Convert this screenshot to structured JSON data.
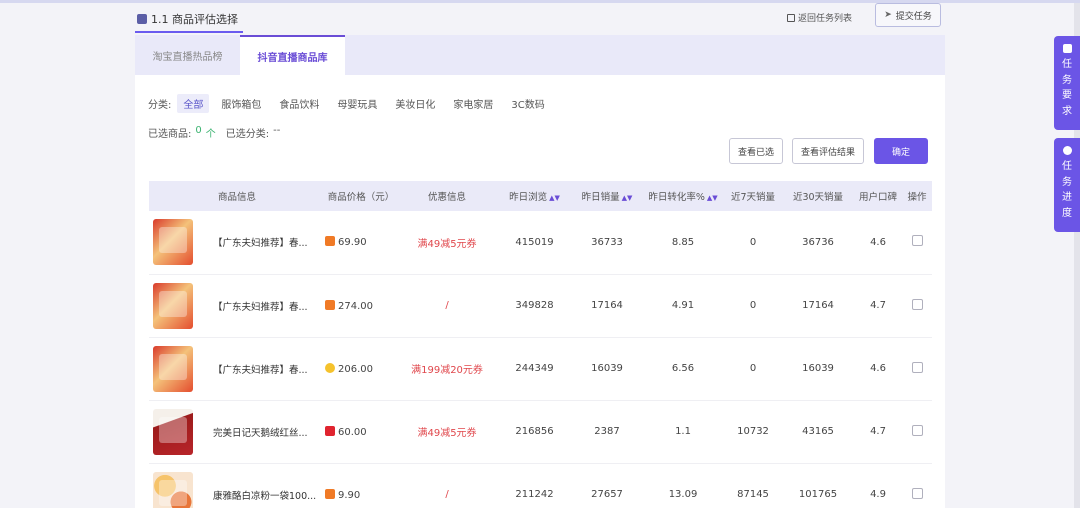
{
  "header": {
    "title": "1.1 商品评估选择",
    "back_label": "返回任务列表",
    "submit_label": "提交任务"
  },
  "tabs": [
    {
      "label": "淘宝直播热品榜"
    },
    {
      "label": "抖音直播商品库"
    }
  ],
  "filters": {
    "category_label": "分类:",
    "categories": [
      "全部",
      "服饰箱包",
      "食品饮料",
      "母婴玩具",
      "美妆日化",
      "家电家居",
      "3C数码"
    ],
    "selected_goods_label": "已选商品:",
    "selected_goods_count": "0",
    "selected_goods_unit": "个",
    "selected_cat_label": "已选分类:",
    "selected_cat_value": "--"
  },
  "actions": {
    "view_selected": "查看已选",
    "view_results": "查看评估结果",
    "confirm": "确定"
  },
  "table": {
    "headers": [
      "商品信息",
      "商品价格（元）",
      "优惠信息",
      "昨日浏览",
      "昨日销量",
      "昨日转化率%",
      "近7天销量",
      "近30天销量",
      "用户口碑",
      "操作"
    ],
    "rows": [
      {
        "name": "【广东夫妇推荐】春...",
        "price": "69.90",
        "platform": "orange",
        "promo": "满49减5元券",
        "views": "415019",
        "sales": "36733",
        "conv": "8.85",
        "s7": "0",
        "s30": "36736",
        "rating": "4.6",
        "img": "red"
      },
      {
        "name": "【广东夫妇推荐】春...",
        "price": "274.00",
        "platform": "orange",
        "promo": "/",
        "views": "349828",
        "sales": "17164",
        "conv": "4.91",
        "s7": "0",
        "s30": "17164",
        "rating": "4.7",
        "img": "red"
      },
      {
        "name": "【广东夫妇推荐】春...",
        "price": "206.00",
        "platform": "yellow",
        "promo": "满199减20元券",
        "views": "244349",
        "sales": "16039",
        "conv": "6.56",
        "s7": "0",
        "s30": "16039",
        "rating": "4.6",
        "img": "red"
      },
      {
        "name": "完美日记天鹅绒红丝...",
        "price": "60.00",
        "platform": "red",
        "promo": "满49减5元券",
        "views": "216856",
        "sales": "2387",
        "conv": "1.1",
        "s7": "10732",
        "s30": "43165",
        "rating": "4.7",
        "img": "dark"
      },
      {
        "name": "康雅酪白凉粉一袋100...",
        "price": "9.90",
        "platform": "orange",
        "promo": "/",
        "views": "211242",
        "sales": "27657",
        "conv": "13.09",
        "s7": "87145",
        "s30": "101765",
        "rating": "4.9",
        "img": "food"
      }
    ]
  },
  "side": {
    "requirements": [
      "任",
      "务",
      "要",
      "求"
    ],
    "progress": [
      "任",
      "务",
      "进",
      "度"
    ]
  },
  "colors": {
    "accent": "#6b55e6",
    "promo": "#e0474c",
    "green": "#3cb371"
  }
}
